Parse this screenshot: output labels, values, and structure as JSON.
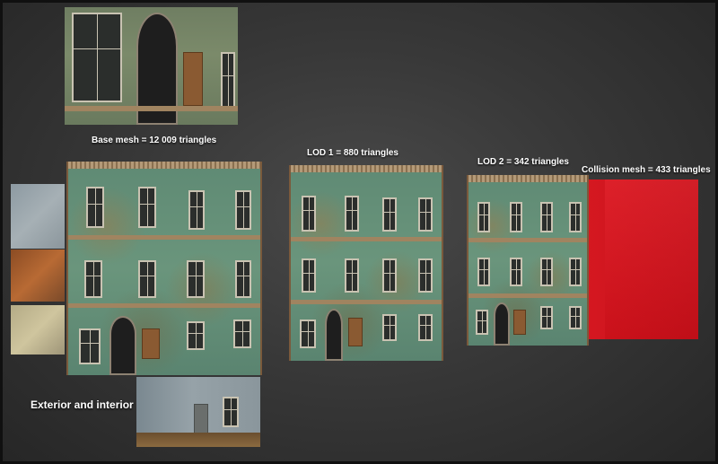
{
  "labels": {
    "base_mesh": "Base mesh =  12 009 triangles",
    "lod1": "LOD 1 = 880 triangles",
    "lod2": "LOD 2 = 342 triangles",
    "collision": "Collision mesh = 433 triangles",
    "exterior_interior": "Exterior and interior"
  },
  "colors": {
    "background": "#383838",
    "facade": "#6a957c",
    "collision": "#e0141e",
    "text": "#ffffff"
  }
}
